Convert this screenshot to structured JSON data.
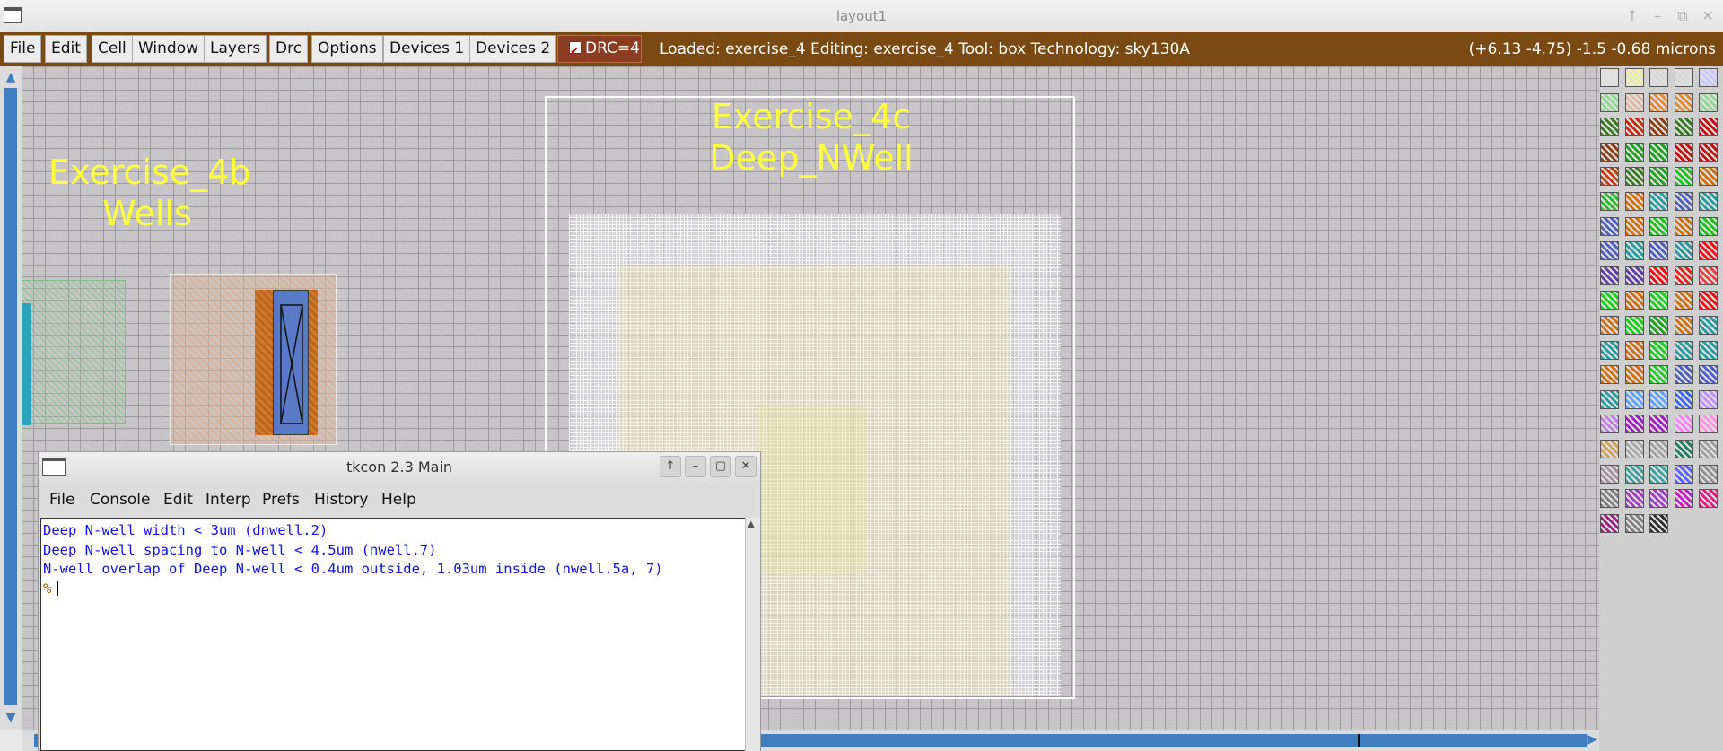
{
  "window": {
    "title": "layout1"
  },
  "wm_buttons": [
    "↑",
    "–",
    "⧉",
    "✕"
  ],
  "menubar": {
    "items": [
      "File",
      "Edit",
      "Cell",
      "Window",
      "Layers",
      "Drc",
      "Options",
      "Devices 1",
      "Devices 2"
    ],
    "drc_label": "DRC=4",
    "status": "Loaded: exercise_4 Editing: exercise_4 Tool: box  Technology: sky130A",
    "coords": "(+6.13 -4.75) -1.5 -0.68 microns",
    "bg_color": "#7b4a13"
  },
  "layout": {
    "label_4b_line1": "Exercise_4b",
    "label_4b_line2": "Wells",
    "label_4c_line1": "Exercise_4c",
    "label_4c_line2": "Deep_NWell",
    "label_color": "#ffff3b"
  },
  "tkcon": {
    "title": "tkcon 2.3 Main",
    "menu": [
      "File",
      "Console",
      "Edit",
      "Interp",
      "Prefs",
      "History",
      "Help"
    ],
    "lines": [
      "Deep N-well width < 3um (dnwell.2)",
      "Deep N-well spacing to N-well < 4.5um (nwell.7)",
      "N-well overlap of Deep N-well < 0.4um outside, 1.03um inside (nwell.5a, 7)"
    ],
    "prompt": "%",
    "wm_buttons": [
      "↑",
      "–",
      "▢",
      "✕"
    ]
  },
  "palette": {
    "colors": [
      "#e0e0e0",
      "#f0f0a0",
      "#d8d8d8",
      "#d8d8d8",
      "#c8c8ff",
      "#8fd88f",
      "#e0b8a0",
      "#e08a3a",
      "#e08a3a",
      "#8fd88f",
      "#3a7a20",
      "#c03010",
      "#8a4010",
      "#3a7a20",
      "#c01010",
      "#8a4010",
      "#20a020",
      "#20a020",
      "#c01010",
      "#c01010",
      "#c04010",
      "#3a7a20",
      "#20a020",
      "#20c020",
      "#d07010",
      "#20c020",
      "#d07010",
      "#2a9aa0",
      "#5060c0",
      "#2a9aa0",
      "#5060c0",
      "#d07010",
      "#20c020",
      "#d07010",
      "#20c020",
      "#5060c0",
      "#2a9aa0",
      "#5060c0",
      "#2a9aa0",
      "#ee1010",
      "#6040a0",
      "#6040a0",
      "#ee1010",
      "#ee2020",
      "#ee4040",
      "#20cc20",
      "#d07010",
      "#20cc20",
      "#d07010",
      "#ee1010",
      "#d07010",
      "#20cc20",
      "#20a020",
      "#d07010",
      "#2a9aa0",
      "#2a9aa0",
      "#d07010",
      "#20cc20",
      "#2a9aa0",
      "#2a9aa0",
      "#d07010",
      "#d07010",
      "#20cc20",
      "#5060c0",
      "#5060c0",
      "#2a9aa0",
      "#60a0ff",
      "#60a0ff",
      "#4060ff",
      "#c090ff",
      "#c080e0",
      "#a020c0",
      "#a020c0",
      "#ff80ff",
      "#ff90e0",
      "#d0a060",
      "#a8a8a8",
      "#a0a0a0",
      "#208060",
      "#a0a0a0",
      "#a090a0",
      "#40a0a0",
      "#40a0a0",
      "#6060ff",
      "#909090",
      "#808080",
      "#a040c0",
      "#a040c0",
      "#c020c0",
      "#e02080",
      "#a02080",
      "#808080",
      "#303030"
    ]
  }
}
